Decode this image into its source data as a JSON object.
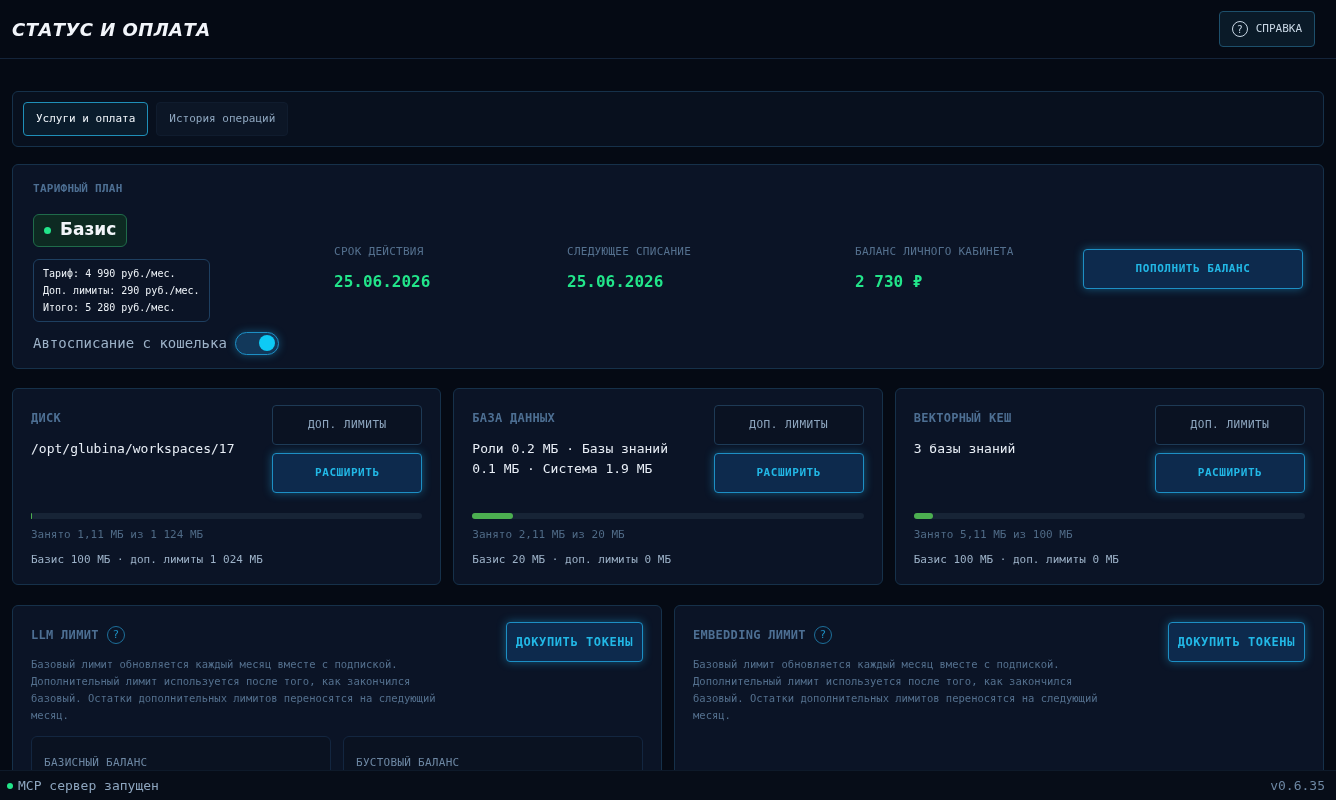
{
  "header": {
    "title": "СТАТУС И ОПЛАТА",
    "help_button": "СПРАВКА",
    "help_icon": "?"
  },
  "tabs": [
    {
      "label": "Услуги и оплата",
      "selected": true
    },
    {
      "label": "История операций",
      "selected": false
    }
  ],
  "plan": {
    "section_label": "ТАРИФНЫЙ ПЛАН",
    "name": "Базис",
    "active": true,
    "price_lines": [
      "Тариф: 4 990 руб./мес.",
      "Доп. лимиты: 290 руб./мес.",
      "Итого: 5 280 руб./мес."
    ],
    "autopay": {
      "label": "Автосписание с кошелька",
      "on": true
    },
    "stats": [
      {
        "label": "СРОК ДЕЙСТВИЯ",
        "value": "25.06.2026"
      },
      {
        "label": "СЛЕДУЮЩЕЕ СПИСАНИЕ",
        "value": "25.06.2026"
      },
      {
        "label": "БАЛАНС ЛИЧНОГО КАБИНЕТА",
        "value": "2 730 ₽"
      }
    ],
    "topup_button": "ПОПОЛНИТЬ БАЛАНС"
  },
  "storage": [
    {
      "title": "ДИСК",
      "detail": "/opt/glubina/workspaces/17",
      "limits_button": "ДОП. ЛИМИТЫ",
      "expand_button": "РАСШИРИТЬ",
      "level": 0.001,
      "used": "Занято 1,11 МБ из 1 124 МБ",
      "quota": "Базис 100 МБ · доп. лимиты 1 024 МБ"
    },
    {
      "title": "БАЗА ДАННЫХ",
      "detail": "Роли 0.2 МБ · Базы знаний 0.1 МБ · Система 1.9 МБ",
      "limits_button": "ДОП. ЛИМИТЫ",
      "expand_button": "РАСШИРИТЬ",
      "level": 0.105,
      "used": "Занято 2,11 МБ из 20 МБ",
      "quota": "Базис 20 МБ · доп. лимиты 0 МБ"
    },
    {
      "title": "ВЕКТОРНЫЙ КЕШ",
      "detail": "3 базы знаний",
      "limits_button": "ДОП. ЛИМИТЫ",
      "expand_button": "РАСШИРИТЬ",
      "level": 0.05,
      "used": "Занято 5,11 МБ из 100 МБ",
      "quota": "Базис 100 МБ · доп. лимиты 0 МБ"
    }
  ],
  "limits": [
    {
      "title": "LLM ЛИМИТ",
      "help_icon": "?",
      "buy_button": "ДОКУПИТЬ ТОКЕНЫ",
      "description": "Базовый лимит обновляется каждый месяц вместе с подпиской. Дополнительный лимит используется после того, как закончился базовый. Остатки дополнительных лимитов переносятся на следующий месяц.",
      "balances": [
        "БАЗИСНЫЙ БАЛАНС",
        "БУСТОВЫЙ БАЛАНС"
      ]
    },
    {
      "title": "EMBEDDING ЛИМИТ",
      "help_icon": "?",
      "buy_button": "ДОКУПИТЬ ТОКЕНЫ",
      "description": "Базовый лимит обновляется каждый месяц вместе с подпиской. Дополнительный лимит используется после того, как закончился базовый. Остатки дополнительных лимитов переносятся на следующий месяц."
    }
  ],
  "status_bar": {
    "server": "MCP сервер запущен",
    "server_running": true,
    "version": "v0.6.35"
  }
}
